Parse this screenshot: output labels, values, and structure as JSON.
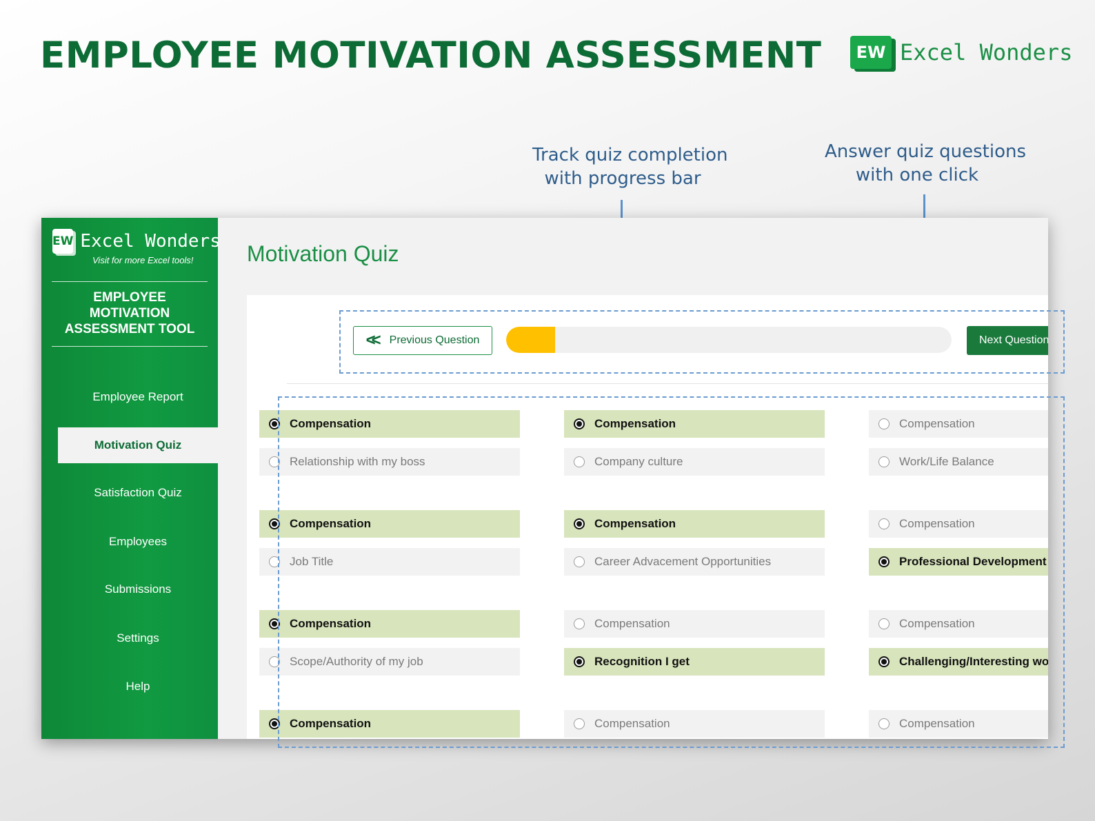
{
  "header": {
    "title": "EMPLOYEE MOTIVATION ASSESSMENT",
    "brand_logo": "EW",
    "brand_name": "Excel Wonders"
  },
  "callouts": [
    {
      "line1": "Track quiz completion",
      "line2": "with progress bar"
    },
    {
      "line1": "Answer quiz questions",
      "line2": "with one click"
    }
  ],
  "sidebar": {
    "brand_logo": "EW",
    "brand_name": "Excel Wonders",
    "tagline": "Visit for more Excel tools!",
    "tool_title_l1": "EMPLOYEE",
    "tool_title_l2": "MOTIVATION",
    "tool_title_l3": "ASSESSMENT TOOL",
    "items": [
      {
        "label": "Employee Report"
      },
      {
        "label": "Motivation Quiz"
      },
      {
        "label": "Satisfaction Quiz"
      },
      {
        "label": "Employees"
      },
      {
        "label": "Submissions"
      },
      {
        "label": "Settings"
      },
      {
        "label": "Help"
      }
    ],
    "active_index": 1
  },
  "main": {
    "title": "Motivation Quiz",
    "prev_label": "Previous Question",
    "next_label": "Next Question",
    "progress": 0.11
  },
  "quiz": {
    "questions": [
      {
        "a": "Compensation",
        "b": "Relationship with my boss",
        "selected": "a"
      },
      {
        "a": "Compensation",
        "b": "Company culture",
        "selected": "a"
      },
      {
        "a": "Compensation",
        "b": "Work/Life Balance",
        "selected": "none"
      },
      {
        "a": "Compensation",
        "b": "Job Title",
        "selected": "a"
      },
      {
        "a": "Compensation",
        "b": "Career Advacement Opportunities",
        "selected": "a"
      },
      {
        "a": "Compensation",
        "b": "Professional Development",
        "selected": "b"
      },
      {
        "a": "Compensation",
        "b": "Scope/Authority of my job",
        "selected": "a"
      },
      {
        "a": "Compensation",
        "b": "Recognition I get",
        "selected": "b"
      },
      {
        "a": "Compensation",
        "b": "Challenging/Interesting work",
        "selected": "b"
      },
      {
        "a": "Compensation",
        "selected": "a"
      },
      {
        "a": "Compensation",
        "selected": "none"
      },
      {
        "a": "Compensation",
        "selected": "none"
      }
    ]
  }
}
